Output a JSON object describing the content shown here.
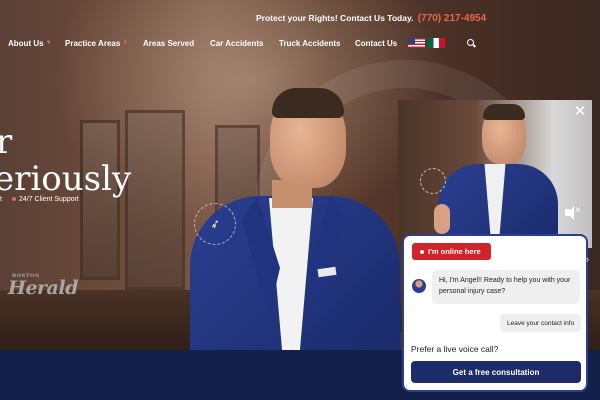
{
  "topbar": {
    "text": "Protect your Rights! Contact Us Today.",
    "phone": "(770) 217-4954",
    "accent": "#e8664e"
  },
  "nav": {
    "items": [
      {
        "label": "About Us",
        "dropdown": true
      },
      {
        "label": "Practice Areas",
        "dropdown": true
      },
      {
        "label": "Areas Served",
        "dropdown": false
      },
      {
        "label": "Car Accidents",
        "dropdown": false
      },
      {
        "label": "Truck Accidents",
        "dropdown": false
      },
      {
        "label": "Contact Us",
        "dropdown": false
      }
    ],
    "flags": [
      "us-flag-icon",
      "mexico-flag-icon"
    ],
    "search_icon": "search-icon"
  },
  "hero": {
    "headline_line1": "r",
    "headline_line2": "eriously",
    "tagline_left": "t",
    "tagline_right": "24/7 Client Support",
    "press_logo": "Herald",
    "press_logo_small": "BOSTON"
  },
  "chat": {
    "online_label": "I'm online here",
    "message": "Hi, I'm Angel!! Ready to help you with your personal injury case?",
    "reply_button": "Leave your contact info",
    "voice_prompt": "Prefer a live voice call?",
    "cta_button": "Get a free consultation",
    "brand_color": "#1d2b6b",
    "online_color": "#d0232a"
  },
  "video": {
    "close_icon": "close-icon",
    "mute_icon": "mute-icon"
  }
}
